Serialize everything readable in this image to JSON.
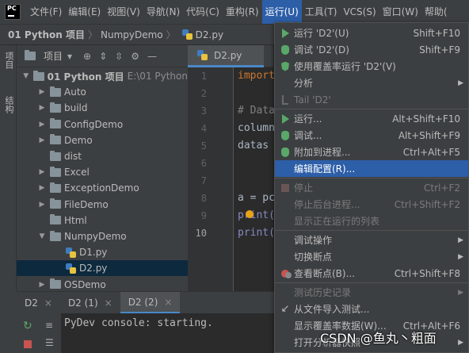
{
  "menubar": {
    "items": [
      "文件(F)",
      "编辑(E)",
      "视图(V)",
      "导航(N)",
      "代码(C)",
      "重构(R)",
      "运行(U)",
      "工具(T)",
      "VCS(S)",
      "窗口(W)",
      "帮助("
    ],
    "active_index": 6
  },
  "breadcrumb": [
    "01 Python 项目",
    "NumpyDemo",
    "D2.py"
  ],
  "leftstrip": {
    "project_tab": "项目",
    "structure_tab": "结构"
  },
  "project": {
    "title": "项目",
    "tree": [
      {
        "label": "01 Python 项目",
        "suffix": "E:\\01 Python",
        "kind": "folder",
        "expanded": true,
        "level": 0,
        "bold": true
      },
      {
        "label": "Auto",
        "kind": "folder",
        "level": 1
      },
      {
        "label": "build",
        "kind": "folder",
        "level": 1
      },
      {
        "label": "ConfigDemo",
        "kind": "folder",
        "level": 1
      },
      {
        "label": "Demo",
        "kind": "folder",
        "level": 1
      },
      {
        "label": "dist",
        "kind": "folder",
        "level": 1,
        "noarrow": true
      },
      {
        "label": "Excel",
        "kind": "folder",
        "level": 1
      },
      {
        "label": "ExceptionDemo",
        "kind": "folder",
        "level": 1
      },
      {
        "label": "FileDemo",
        "kind": "folder",
        "level": 1
      },
      {
        "label": "Html",
        "kind": "folder",
        "level": 1,
        "noarrow": true
      },
      {
        "label": "NumpyDemo",
        "kind": "folder",
        "level": 1,
        "expanded": true
      },
      {
        "label": "D1.py",
        "kind": "py",
        "level": 2
      },
      {
        "label": "D2.py",
        "kind": "py",
        "level": 2,
        "selected": true
      },
      {
        "label": "OSDemo",
        "kind": "folder",
        "level": 1
      }
    ]
  },
  "editor": {
    "tab": "D2.py",
    "line_numbers": [
      "1",
      "2",
      "3",
      "4",
      "5",
      "6",
      "7",
      "8",
      "9",
      "10"
    ],
    "current_line": "10",
    "code": [
      {
        "text": "import",
        "cls": "kw"
      },
      {
        "text": "",
        "cls": ""
      },
      {
        "text": "# Data",
        "cls": "cm"
      },
      {
        "text": "column",
        "cls": ""
      },
      {
        "text": "datas",
        "cls": ""
      },
      {
        "text": "",
        "cls": ""
      },
      {
        "text": "",
        "cls": ""
      },
      {
        "text": "a = pc",
        "cls": ""
      },
      {
        "text": "print(",
        "cls": "fn"
      },
      {
        "text": "print(",
        "cls": "fn"
      }
    ]
  },
  "bottom": {
    "tabs": [
      "D2",
      "D2 (1)",
      "D2 (2)"
    ],
    "active_index": 2,
    "console_text": "PyDev console: starting."
  },
  "dropdown": {
    "items": [
      {
        "icon": "play",
        "label": "运行 'D2'(U)",
        "shortcut": "Shift+F10"
      },
      {
        "icon": "bug",
        "label": "调试 'D2'(D)",
        "shortcut": "Shift+F9"
      },
      {
        "icon": "shield",
        "label": "使用覆盖率运行 'D2'(V)",
        "shortcut": ""
      },
      {
        "icon": "",
        "label": "分析",
        "shortcut": "",
        "submenu": true
      },
      {
        "icon": "tail",
        "label": "Tail 'D2'",
        "shortcut": "",
        "disabled": true
      },
      {
        "sep": true
      },
      {
        "icon": "play",
        "label": "运行...",
        "shortcut": "Alt+Shift+F10"
      },
      {
        "icon": "bug",
        "label": "调试...",
        "shortcut": "Alt+Shift+F9"
      },
      {
        "icon": "attach",
        "label": "附加到进程...",
        "shortcut": "Ctrl+Alt+F5"
      },
      {
        "icon": "",
        "label": "编辑配置(R)...",
        "shortcut": "",
        "highlight": true
      },
      {
        "sep": true
      },
      {
        "icon": "stop",
        "label": "停止",
        "shortcut": "Ctrl+F2",
        "disabled": true
      },
      {
        "icon": "",
        "label": "停止后台进程...",
        "shortcut": "Ctrl+Shift+F2",
        "disabled": true
      },
      {
        "icon": "",
        "label": "显示正在运行的列表",
        "shortcut": "",
        "disabled": true
      },
      {
        "sep": true
      },
      {
        "icon": "",
        "label": "调试操作",
        "shortcut": "",
        "submenu": true
      },
      {
        "icon": "",
        "label": "切换断点",
        "shortcut": "",
        "submenu": true
      },
      {
        "icon": "break",
        "label": "查看断点(B)...",
        "shortcut": "Ctrl+Shift+F8"
      },
      {
        "sep": true
      },
      {
        "icon": "",
        "label": "测试历史记录",
        "shortcut": "",
        "disabled": true,
        "submenu": true
      },
      {
        "icon": "import",
        "label": "从文件导入测试...",
        "shortcut": ""
      },
      {
        "icon": "",
        "label": "显示覆盖率数据(W)...",
        "shortcut": "Ctrl+Alt+F6"
      },
      {
        "icon": "",
        "label": "打开分析器快照",
        "shortcut": "",
        "submenu": true
      }
    ]
  },
  "watermark": "CSDN @鱼丸丶粗面"
}
